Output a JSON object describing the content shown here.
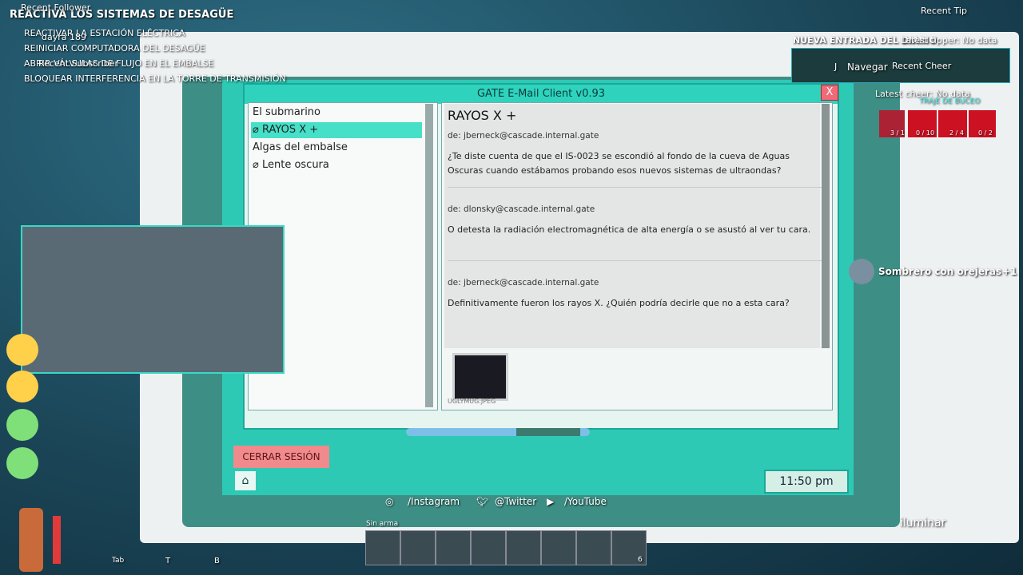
{
  "window": {
    "title": "GATE E-Mail Client v0.93",
    "close": "X"
  },
  "inbox": {
    "items": [
      {
        "label": "El submarino",
        "icon": ""
      },
      {
        "label": "RAYOS X +",
        "icon": "paperclip-icon",
        "selected": true
      },
      {
        "label": "Algas del embalse",
        "icon": ""
      },
      {
        "label": "Lente oscura",
        "icon": "paperclip-icon"
      }
    ]
  },
  "reader": {
    "subject": "RAYOS X +",
    "messages": [
      {
        "from": "de: jberneck@cascade.internal.gate",
        "body": "¿Te diste cuenta de que el IS-0023 se escondió al fondo de la cueva de Aguas Oscuras cuando estábamos probando esos nuevos sistemas de ultraondas?"
      },
      {
        "from": "de: dlonsky@cascade.internal.gate",
        "body": "O detesta la radiación electromagnética de alta energía o se asustó al ver tu cara."
      },
      {
        "from": "de: jberneck@cascade.internal.gate",
        "body": "Definitivamente fueron los rayos X. ¿Quién podría decirle que no a esta cara?"
      }
    ],
    "attachment": "UGLYMUG.JPEG"
  },
  "logout": "CERRAR SESIÓN",
  "clock": "11:50 pm",
  "objectives": {
    "title": "REACTIVA LOS SISTEMAS DE DESAGÜE",
    "items": [
      "REACTIVAR LA ESTACIÓN ELÉCTRICA",
      "REINICIAR COMPUTADORA DEL DESAGÜE",
      "ABRIR VÁLVULAS DE FLUJO EN EL EMBALSE",
      "BLOQUEAR INTERFERENCIA EN LA TORRE DE TRANSMISIÓN"
    ]
  },
  "stream": {
    "recent_follower": "Recent Follower",
    "follower_name": "dayra 189",
    "recent_subscriber": "Recent Subscriber",
    "recent_tip": "Recent Tip",
    "latest_tipper": "Latest tipper: No data",
    "recent_cheer": "Recent Cheer",
    "latest_cheer": "Latest cheer: No data",
    "instagram": "/Instagram",
    "twitter": "@Twitter",
    "youtube": "/YouTube"
  },
  "game": {
    "log_entry": "NUEVA ENTRADA DEL DIARIO",
    "navigate_key": "J",
    "navigate_label": "Navegar",
    "pickup": "Sombrero con orejeras",
    "pickup_count": "+1",
    "illuminate": "iluminar",
    "no_weapon": "Sin arma",
    "suit_label": "TRAJE DE BUCEO",
    "resources": [
      "3 / 1",
      "0 / 10",
      "2 / 4",
      "0 / 2"
    ],
    "keys": [
      "Tab",
      "T",
      "B"
    ],
    "hotbar_count": "6"
  },
  "colors": {
    "accent": "#2ec9b4",
    "logout": "#f08a8c",
    "selected": "#46e0c8"
  }
}
